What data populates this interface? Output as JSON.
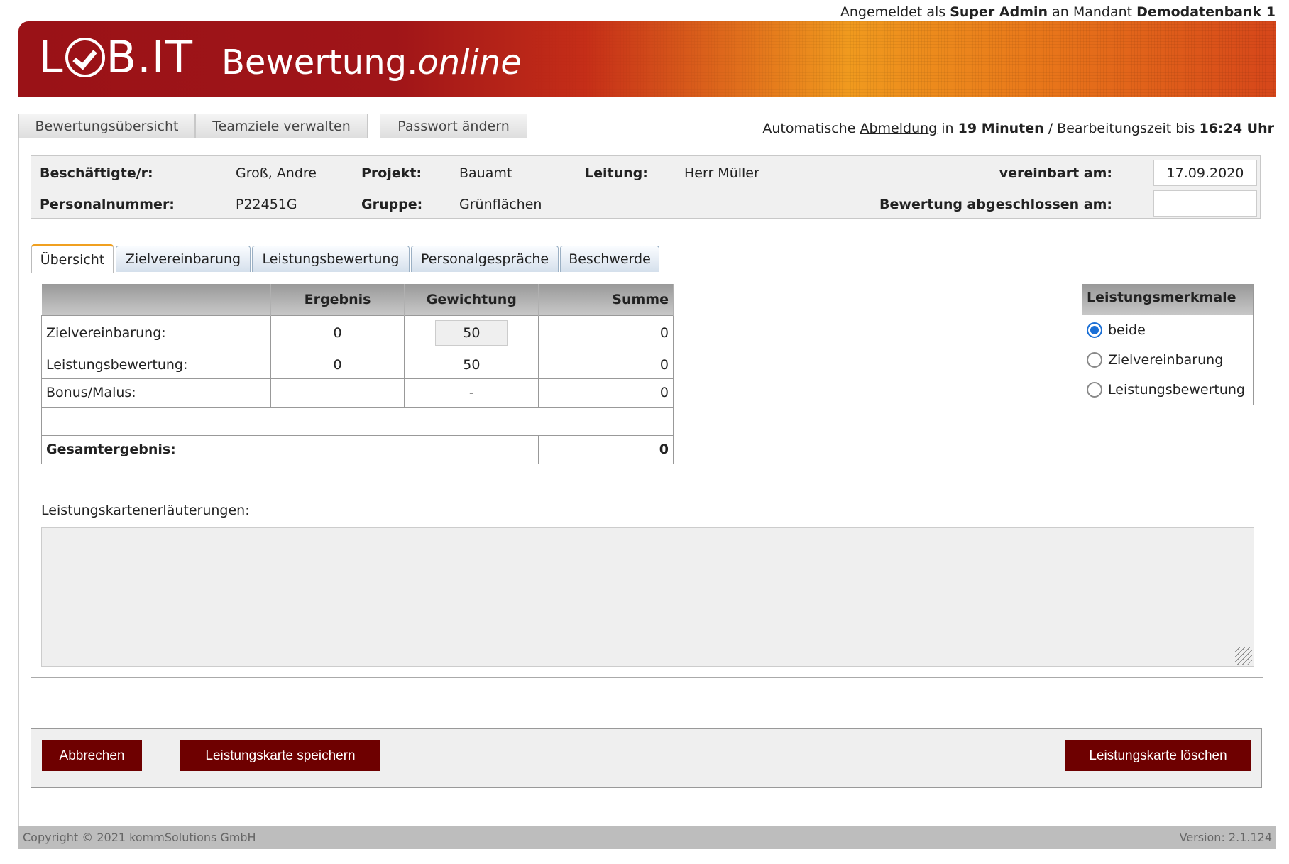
{
  "header": {
    "login_prefix": "Angemeldet als",
    "user": "Super Admin",
    "login_middle": "an Mandant",
    "tenant": "Demodatenbank 1",
    "logo_text_l": "L",
    "logo_text_rest": "B.IT",
    "product_name": "Bewertung.",
    "product_suffix": "online"
  },
  "nav": {
    "items": [
      "Bewertungsübersicht",
      "Teamziele verwalten",
      "Passwort ändern"
    ]
  },
  "session": {
    "prefix": "Automatische",
    "link": "Abmeldung",
    "in": "in",
    "remaining": "19 Minuten",
    "sep": "/ Bearbeitungszeit bis",
    "until": "16:24 Uhr"
  },
  "info": {
    "employee_label": "Beschäftigte/r:",
    "employee": "Groß, Andre",
    "project_label": "Projekt:",
    "project": "Bauamt",
    "lead_label": "Leitung:",
    "lead": "Herr Müller",
    "agreed_label": "vereinbart am:",
    "agreed": "17.09.2020",
    "number_label": "Personalnummer:",
    "number": "P22451G",
    "group_label": "Gruppe:",
    "group": "Grünflächen",
    "closed_label": "Bewertung abgeschlossen am:",
    "closed": ""
  },
  "tabs": [
    "Übersicht",
    "Zielvereinbarung",
    "Leistungsbewertung",
    "Personalgespräche",
    "Beschwerde"
  ],
  "table": {
    "headers": [
      "",
      "Ergebnis",
      "Gewichtung",
      "Summe"
    ],
    "rows": [
      {
        "label": "Zielvereinbarung:",
        "ergebnis": "0",
        "gewichtung": "50",
        "summe": "0"
      },
      {
        "label": "Leistungsbewertung:",
        "ergebnis": "0",
        "gewichtung": "50",
        "summe": "0"
      },
      {
        "label": "Bonus/Malus:",
        "ergebnis": "",
        "gewichtung": "-",
        "summe": "0"
      }
    ],
    "total_label": "Gesamtergebnis:",
    "total": "0"
  },
  "merkmale": {
    "title": "Leistungsmerkmale",
    "options": [
      "beide",
      "Zielvereinbarung",
      "Leistungsbewertung"
    ],
    "selected": "beide"
  },
  "notes": {
    "label": "Leistungskartenerläuterungen:",
    "value": ""
  },
  "buttons": {
    "cancel": "Abbrechen",
    "save": "Leistungskarte speichern",
    "delete": "Leistungskarte löschen"
  },
  "footer": {
    "copyright": "Copyright © 2021 kommSolutions GmbH",
    "version": "Version: 2.1.124"
  },
  "colors": {
    "button": "#6e0000",
    "active_tab": "#f0a020",
    "radio": "#1a6fd6"
  }
}
